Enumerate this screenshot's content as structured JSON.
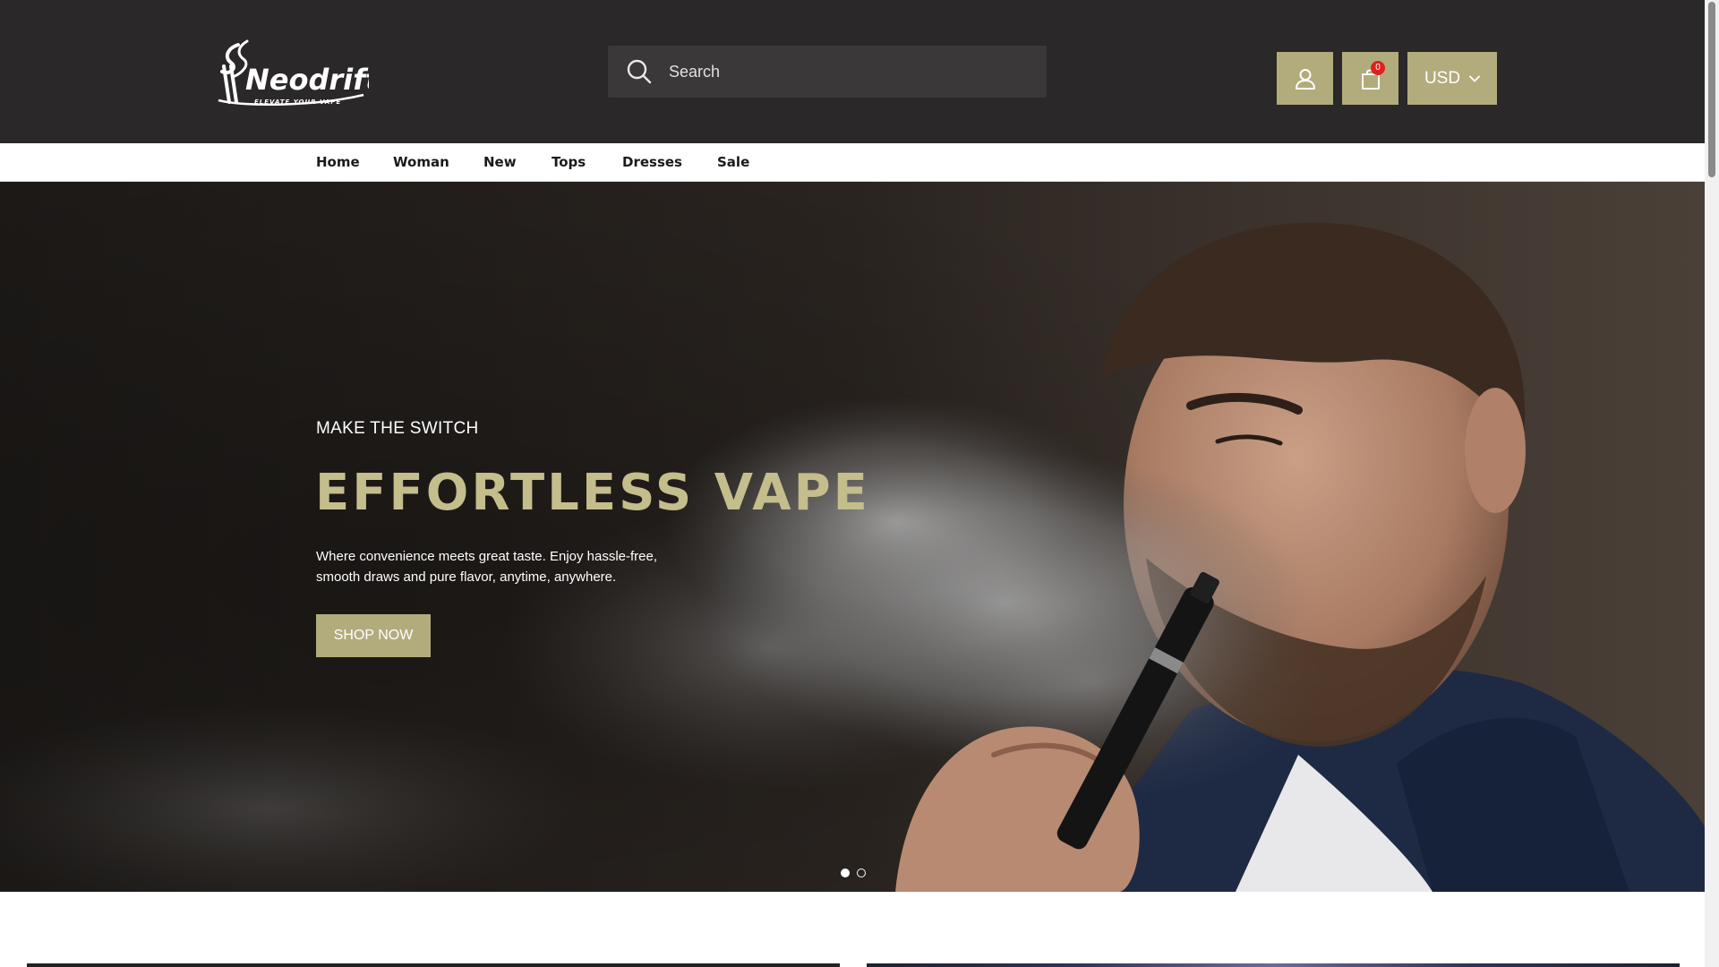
{
  "header": {
    "logo_text": "Neodrift",
    "logo_tagline": "ELEVATE YOUR VAPE",
    "search": {
      "placeholder": "Search",
      "icon": "search-icon"
    },
    "account_icon": "user-icon",
    "cart": {
      "icon": "shopping-bag-icon",
      "count": "0"
    },
    "currency": {
      "value": "USD",
      "icon": "chevron-down-icon"
    },
    "accent_color": "#b2ab7c",
    "background_color": "#2a2828"
  },
  "nav": {
    "items": [
      {
        "label": "Home"
      },
      {
        "label": "Woman"
      },
      {
        "label": "New"
      },
      {
        "label": "Tops"
      },
      {
        "label": "Dresses"
      },
      {
        "label": "Sale"
      }
    ]
  },
  "hero": {
    "kicker": "MAKE THE SWITCH",
    "title": "EFFORTLESS VAPE",
    "description": "Where convenience meets great taste. Enjoy hassle-free, smooth draws and pure flavor, anytime, anywhere.",
    "cta_label": "SHOP NOW",
    "title_color": "#c4bd8c",
    "slides": {
      "count": 2,
      "active": 1
    }
  }
}
